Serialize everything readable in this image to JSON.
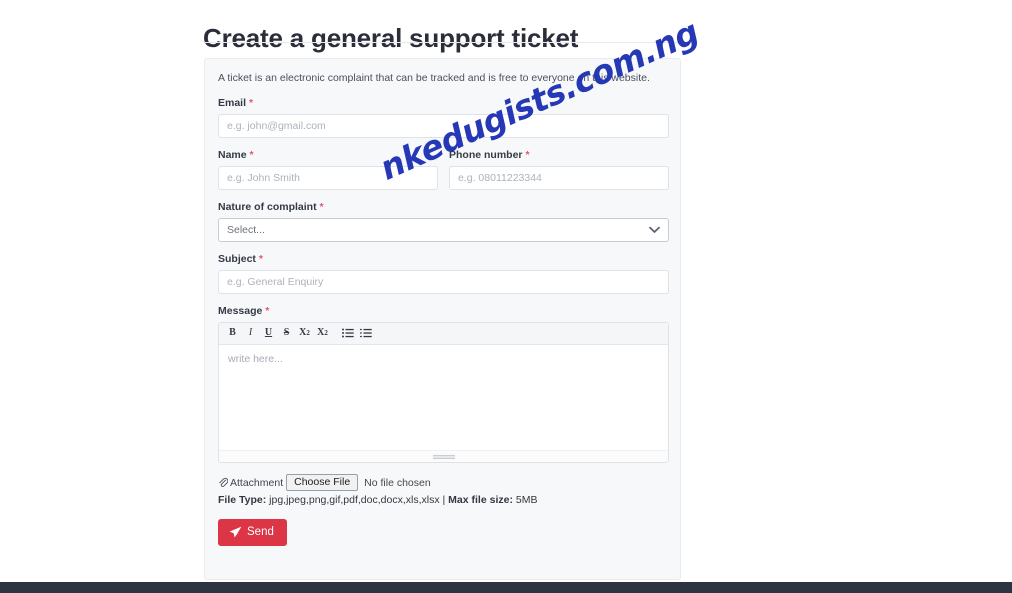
{
  "page": {
    "title": "Create a general support ticket"
  },
  "form": {
    "intro": "A ticket is an electronic complaint that can be tracked and is free to everyone on this website.",
    "required_mark": "*",
    "email": {
      "label": "Email",
      "placeholder": "e.g. john@gmail.com",
      "value": ""
    },
    "name": {
      "label": "Name",
      "placeholder": "e.g. John Smith",
      "value": ""
    },
    "phone": {
      "label": "Phone number",
      "placeholder": "e.g. 08011223344",
      "value": ""
    },
    "nature": {
      "label": "Nature of complaint",
      "selected": "Select...",
      "options": [
        "Select..."
      ]
    },
    "subject": {
      "label": "Subject",
      "placeholder": "e.g. General Enquiry",
      "value": ""
    },
    "message": {
      "label": "Message",
      "placeholder": "write here...",
      "value": ""
    },
    "toolbar": {
      "bold": "B",
      "italic": "I",
      "underline": "U",
      "strikethrough": "S",
      "superscript_base": "X",
      "superscript_exp": "2",
      "subscript_base": "X",
      "subscript_exp": "2"
    },
    "attachment": {
      "label": "Attachment",
      "choose_file_label": "Choose File",
      "no_file_text": "No file chosen",
      "filetype_prefix": "File Type:",
      "filetype_list": "jpg,jpeg,png,gif,pdf,doc,docx,xls,xlsx",
      "separator": "|",
      "maxsize_prefix": "Max file size:",
      "maxsize_value": "5MB"
    },
    "submit": {
      "label": "Send"
    }
  },
  "watermark": {
    "text": "nkedugists.com.ng"
  },
  "colors": {
    "accent_red": "#dc3545",
    "required_red": "#e8556d",
    "watermark_blue": "#1f32b4",
    "footer_dark": "#2c3441",
    "card_bg": "#f7f8fa"
  }
}
